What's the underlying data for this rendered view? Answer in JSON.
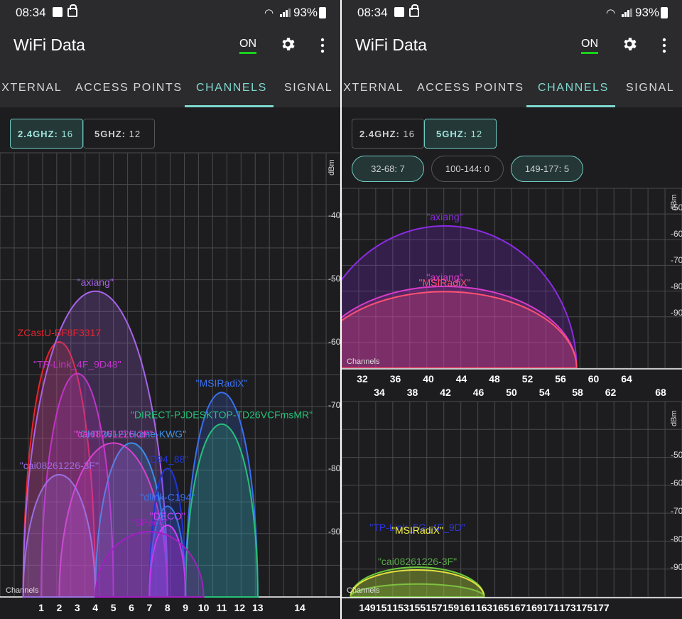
{
  "status": {
    "time": "08:34",
    "battery": "93%"
  },
  "app": {
    "title": "WiFi Data",
    "power_label": "ON"
  },
  "tabs": [
    "EXTERNAL",
    "ACCESS POINTS",
    "CHANNELS",
    "SIGNAL"
  ],
  "bands": {
    "band24": {
      "label": "2.4GHZ:",
      "count": "16"
    },
    "band5": {
      "label": "5GHZ:",
      "count": "12"
    }
  },
  "subbands": [
    {
      "label": "32-68:",
      "count": "7"
    },
    {
      "label": "100-144:",
      "count": "0"
    },
    {
      "label": "149-177:",
      "count": "5"
    }
  ],
  "channels_label": "Channels",
  "dbm_label": "dBm",
  "colors": {
    "active": "#7fd8cf",
    "on": "#18d11b",
    "bg": "#1d1d1f",
    "bar": "#2b2b2d"
  },
  "chart_data": [
    {
      "type": "area",
      "title": "",
      "xlabel": "Channels",
      "ylabel": "dBm",
      "x_ticks": [
        1,
        2,
        3,
        4,
        5,
        6,
        7,
        8,
        9,
        10,
        11,
        12,
        13,
        14
      ],
      "y_ticks": [
        -40,
        -50,
        -60,
        -70,
        -80,
        -90
      ],
      "xlim": [
        -1,
        16
      ],
      "ylim": [
        -100,
        -30
      ],
      "series": [
        {
          "name": "ZCastU-BF8F3317",
          "center": 2,
          "width": 2,
          "level": -60,
          "color": "#e5252e"
        },
        {
          "name": "\"axiang\"",
          "center": 4,
          "width": 4,
          "level": -52,
          "color": "#a764e8"
        },
        {
          "name": "\"TP-Link_4F_9D48\"",
          "center": 3,
          "width": 2,
          "level": -65,
          "color": "#c034c8"
        },
        {
          "name": "\"MSIRadiX\"",
          "center": 11,
          "width": 2,
          "level": -68,
          "color": "#3a6ff0"
        },
        {
          "name": "\"DIRECT-PJDESKTOP-TD26VCFmsMR\"",
          "center": 11,
          "width": 2,
          "level": -73,
          "color": "#27c07a"
        },
        {
          "name": "\"CHT Wi-Fi Home-KWG\"",
          "center": 6,
          "width": 2,
          "level": -76,
          "color": "#3a8fe6"
        },
        {
          "name": "\"cai08261226-2F\"",
          "center": 5,
          "width": 3,
          "level": -76,
          "color": "#d940d0"
        },
        {
          "name": "\"cai08261226-3F\"",
          "center": 2,
          "width": 2,
          "level": -81,
          "color": "#9a6fe0"
        },
        {
          "name": "\"D94_88\"",
          "center": 8,
          "width": 1,
          "level": -80,
          "color": "#1f35d6"
        },
        {
          "name": "\"dlink-C194\"",
          "center": 8,
          "width": 1,
          "level": -86,
          "color": "#3a72e8"
        },
        {
          "name": "\"DECO\"",
          "center": 8,
          "width": 1,
          "level": -89,
          "color": "#d040ff"
        },
        {
          "name": "\"SPeco\"",
          "center": 7,
          "width": 3,
          "level": -90,
          "color": "#a020c0"
        }
      ]
    },
    {
      "type": "area",
      "xlabel": "Channels",
      "ylabel": "dBm",
      "x_ticks_top": [
        32,
        36,
        40,
        44,
        48,
        52,
        56,
        60,
        64
      ],
      "x_ticks_bottom": [
        34,
        38,
        42,
        46,
        50,
        54,
        58,
        62,
        68
      ],
      "y_ticks": [
        -50,
        -60,
        -70,
        -80,
        -90
      ],
      "series": [
        {
          "name": "\"axiang\"",
          "center": 42,
          "width": 16,
          "level": -57,
          "color": "#8a2be2"
        },
        {
          "name": "\"axiang\"",
          "center": 42,
          "width": 16,
          "level": -80,
          "color": "#d83cc8"
        },
        {
          "name": "\"MSIRadiX\"",
          "center": 42,
          "width": 16,
          "level": -82,
          "color": "#ff5070"
        }
      ]
    },
    {
      "type": "area",
      "xlabel": "Channels",
      "ylabel": "dBm",
      "x_ticks": [
        149,
        151,
        153,
        155,
        157,
        159,
        161,
        163,
        165,
        167,
        169,
        171,
        173,
        175,
        177
      ],
      "y_ticks": [
        -50,
        -60,
        -70,
        -80,
        -90
      ],
      "series": [
        {
          "name": "\"TP-Link_5G_4F_9D\"",
          "center": 155,
          "width": 8,
          "level": -90,
          "color": "#6ec93a"
        },
        {
          "name": "\"MSIRadiX\"",
          "center": 155,
          "width": 8,
          "level": -91,
          "color": "#e6e040"
        },
        {
          "name": "\"cai08261226-3F\"",
          "center": 155,
          "width": 8,
          "level": -96,
          "color": "#7fc040"
        }
      ]
    }
  ]
}
